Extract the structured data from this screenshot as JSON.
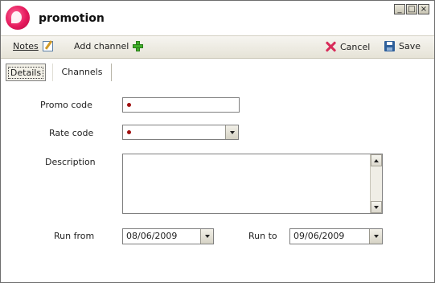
{
  "window": {
    "title": "promotion",
    "controls": [
      "_",
      "□",
      "×"
    ]
  },
  "toolbar": {
    "notes_label": "Notes",
    "add_channel_label": "Add channel",
    "cancel_label": "Cancel",
    "save_label": "Save"
  },
  "tabs": [
    {
      "label": "Details",
      "selected": true
    },
    {
      "label": "Channels",
      "selected": false
    }
  ],
  "form": {
    "promo_code": {
      "label": "Promo code",
      "value": "",
      "required": true
    },
    "rate_code": {
      "label": "Rate code",
      "value": "",
      "required": true
    },
    "description": {
      "label": "Description",
      "value": ""
    },
    "run_from": {
      "label": "Run from",
      "value": "08/06/2009"
    },
    "run_to": {
      "label": "Run to",
      "value": "09/06/2009"
    }
  },
  "colors": {
    "brand": "#e5195c",
    "toolbar_bg": "#ece9dc",
    "required_marker": "#a01010"
  }
}
